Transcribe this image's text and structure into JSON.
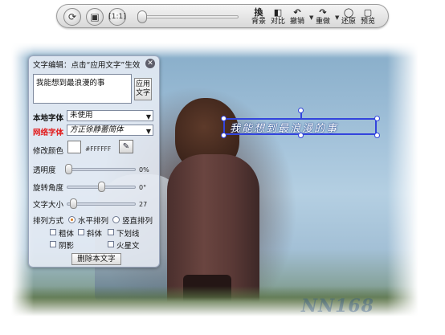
{
  "toolbar": {
    "tools": [
      {
        "icon": "換",
        "label": "背景",
        "name": "background"
      },
      {
        "icon": "◧",
        "label": "对比",
        "name": "compare"
      },
      {
        "icon": "↶",
        "label": "撤销",
        "name": "undo"
      },
      {
        "icon": "↷",
        "label": "重做",
        "name": "redo"
      },
      {
        "icon": "◯",
        "label": "还原",
        "name": "restore"
      },
      {
        "icon": "▢",
        "label": "预览",
        "name": "preview"
      }
    ],
    "zoom_slider_value": 0.0
  },
  "canvas": {
    "overlay_text": "我能想到最浪漫的事",
    "watermark": "NN168"
  },
  "panel": {
    "title": "文字编辑：点击“应用文字”生效",
    "text_value": "我能想到最浪漫的事",
    "apply_label": "应用文字",
    "local_font_label": "本地字体",
    "local_font_value": "未使用",
    "web_font_label": "网络字体",
    "web_font_value": "方正徐静蕾简体",
    "color_label": "修改颜色",
    "color_hex": "#FFFFFF",
    "color_value": "#ffffff",
    "opacity_label": "透明度",
    "opacity_value": "0%",
    "opacity_level": 0,
    "rotation_label": "旋转角度",
    "rotation_value": "0°",
    "rotation_level": 0.5,
    "size_label": "文字大小",
    "size_value": "27",
    "size_level": 0.05,
    "layout_label": "排列方式",
    "horizontal_label": "水平排列",
    "vertical_label": "竖直排列",
    "bold_label": "粗体",
    "italic_label": "斜体",
    "underline_label": "下划线",
    "shadow_label": "阴影",
    "glow_label": "火星文",
    "delete_label": "删除本文字"
  }
}
